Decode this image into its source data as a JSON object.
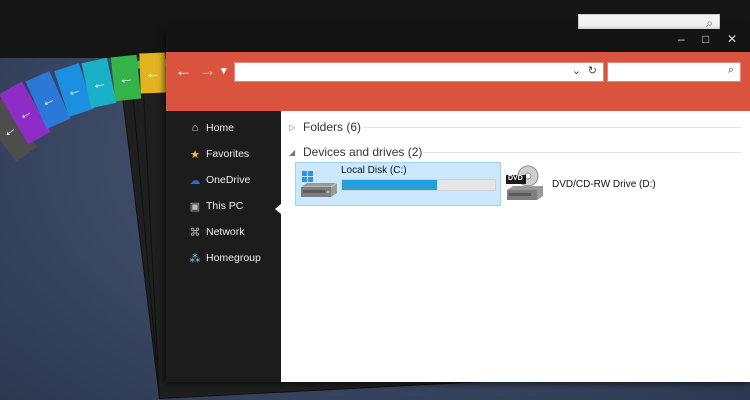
{
  "window": {
    "minimize_glyph": "–",
    "maximize_glyph": "□",
    "close_glyph": "✕"
  },
  "toolbar": {
    "back_glyph": "←",
    "forward_glyph": "→",
    "recent_glyph": "▾",
    "address_value": "",
    "dropdown_glyph": "⌄",
    "refresh_glyph": "↻",
    "search_value": "",
    "search_glyph": "⌕"
  },
  "sidebar": {
    "items": [
      {
        "label": "Home",
        "icon": "home-icon",
        "glyph": "⌂"
      },
      {
        "label": "Favorites",
        "icon": "star-icon",
        "glyph": "★"
      },
      {
        "label": "OneDrive",
        "icon": "cloud-icon",
        "glyph": "☁"
      },
      {
        "label": "This PC",
        "icon": "computer-icon",
        "glyph": "▣"
      },
      {
        "label": "Network",
        "icon": "network-icon",
        "glyph": "⌘"
      },
      {
        "label": "Homegroup",
        "icon": "homegroup-icon",
        "glyph": "⁂"
      }
    ],
    "selected": "This PC"
  },
  "content": {
    "folders_header": "Folders (6)",
    "devices_header": "Devices and drives (2)",
    "drives": [
      {
        "name": "Local Disk (C:)",
        "icon": "hard-drive-icon",
        "used_fraction": 0.62
      },
      {
        "name": "DVD/CD-RW Drive (D:)",
        "icon": "dvd-drive-icon",
        "badge": "DVD"
      }
    ]
  },
  "colors": {
    "accent": "#d9533e",
    "sidebar_bg": "#1c1c1c",
    "selection_bg": "#cce8ff",
    "progress": "#26a0da",
    "fan_tabs": [
      "#4d4d4d",
      "#8e2cc8",
      "#2a79d8",
      "#1d8fe0",
      "#1ab0c8",
      "#34b349",
      "#e2b321"
    ]
  }
}
